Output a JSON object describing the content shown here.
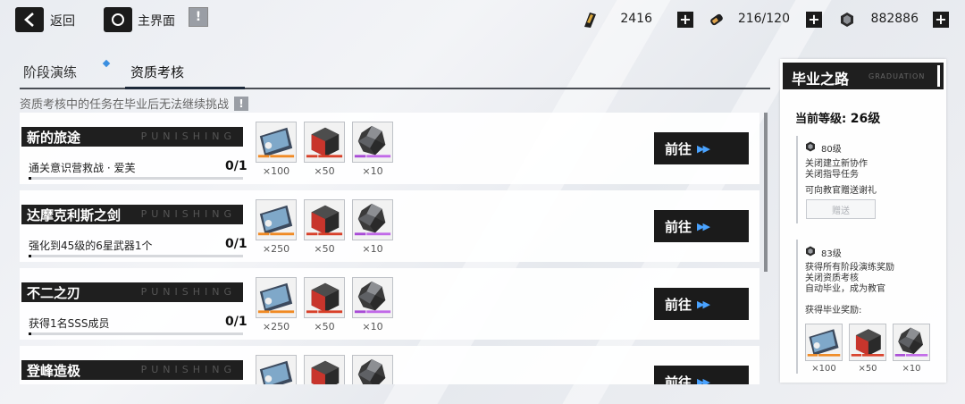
{
  "topbar": {
    "back_label": "返回",
    "home_label": "主界面",
    "info_icon": "!",
    "resources": [
      {
        "name": "ticket",
        "value": "2416"
      },
      {
        "name": "stamina",
        "value": "216/120"
      },
      {
        "name": "coins",
        "value": "882886"
      }
    ],
    "plus": "+"
  },
  "tabs": [
    {
      "label": "阶段演练",
      "active": false
    },
    {
      "label": "资质考核",
      "active": true
    }
  ],
  "notice": "资质考核中的任务在毕业后无法继续挑战",
  "notice_icon": "!",
  "watermark": "PUNISHING",
  "go_label": "前往",
  "go_arrows": "▶▶",
  "tasks": [
    {
      "title": "新的旅途",
      "desc": "通关意识营救战 · 爱芙",
      "progress": "0/1",
      "progress_ratio": 0.0,
      "rewards": [
        "×100",
        "×50",
        "×10"
      ]
    },
    {
      "title": "达摩克利斯之剑",
      "desc": "强化到45级的6星武器1个",
      "progress": "0/1",
      "progress_ratio": 0.0,
      "rewards": [
        "×250",
        "×50",
        "×10"
      ]
    },
    {
      "title": "不二之刃",
      "desc": "获得1名SSS成员",
      "progress": "0/1",
      "progress_ratio": 0.0,
      "rewards": [
        "×250",
        "×50",
        "×10"
      ]
    },
    {
      "title": "登峰造极",
      "desc": "",
      "progress": "",
      "progress_ratio": 0.0,
      "rewards": [
        "",
        "",
        ""
      ]
    }
  ],
  "panel": {
    "title": "毕业之路",
    "watermark": "GRADUATION",
    "level_label": "当前等级:",
    "level_value": "26级",
    "sections": [
      {
        "level": "80级",
        "lines": [
          "关闭建立新协作",
          "关闭指导任务",
          "",
          "可向教官赠送谢礼"
        ],
        "button": "赠送"
      },
      {
        "level": "83级",
        "lines": [
          "获得所有阶段演练奖励",
          "关闭资质考核",
          "自动毕业，成为教官",
          "",
          "获得毕业奖励:"
        ]
      }
    ],
    "grad_rewards": [
      "×100",
      "×50",
      "×10"
    ]
  },
  "colors": {
    "dark": "#1b1b1b",
    "accent_blue": "#3b8fe0",
    "bg": "#eceef2"
  }
}
